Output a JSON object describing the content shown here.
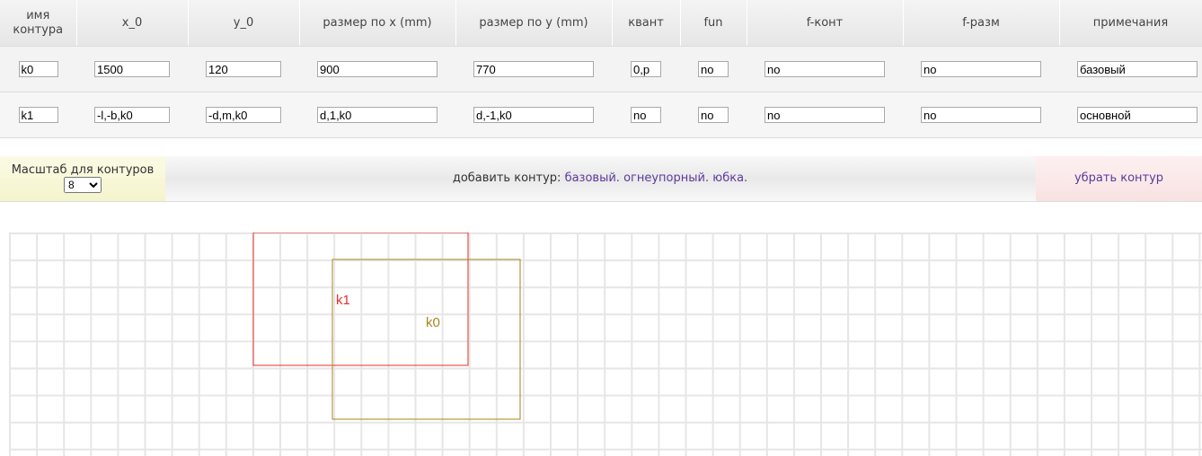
{
  "table": {
    "headers": [
      "имя контура",
      "x_0",
      "y_0",
      "размер по x (mm)",
      "размер по y (mm)",
      "квант",
      "fun",
      "f-конт",
      "f-разм",
      "примечания"
    ],
    "rows": [
      [
        "k0",
        "1500",
        "120",
        "900",
        "770",
        "0,p",
        "no",
        "no",
        "no",
        "базовый"
      ],
      [
        "k1",
        "-l,-b,k0",
        "-d,m,k0",
        "d,1,k0",
        "d,-1,k0",
        "no",
        "no",
        "no",
        "no",
        "основной"
      ]
    ]
  },
  "scale": {
    "label": "Масштаб для контуров",
    "value": "8"
  },
  "add": {
    "prefix": "добавить контур:",
    "links": [
      "базовый.",
      "огнеупорный.",
      "юбка."
    ]
  },
  "remove": {
    "label": "убрать контур"
  },
  "canvas": {
    "contours": [
      {
        "name": "k1",
        "color": "#e8302a"
      },
      {
        "name": "k0",
        "color": "#a8861a"
      }
    ]
  }
}
